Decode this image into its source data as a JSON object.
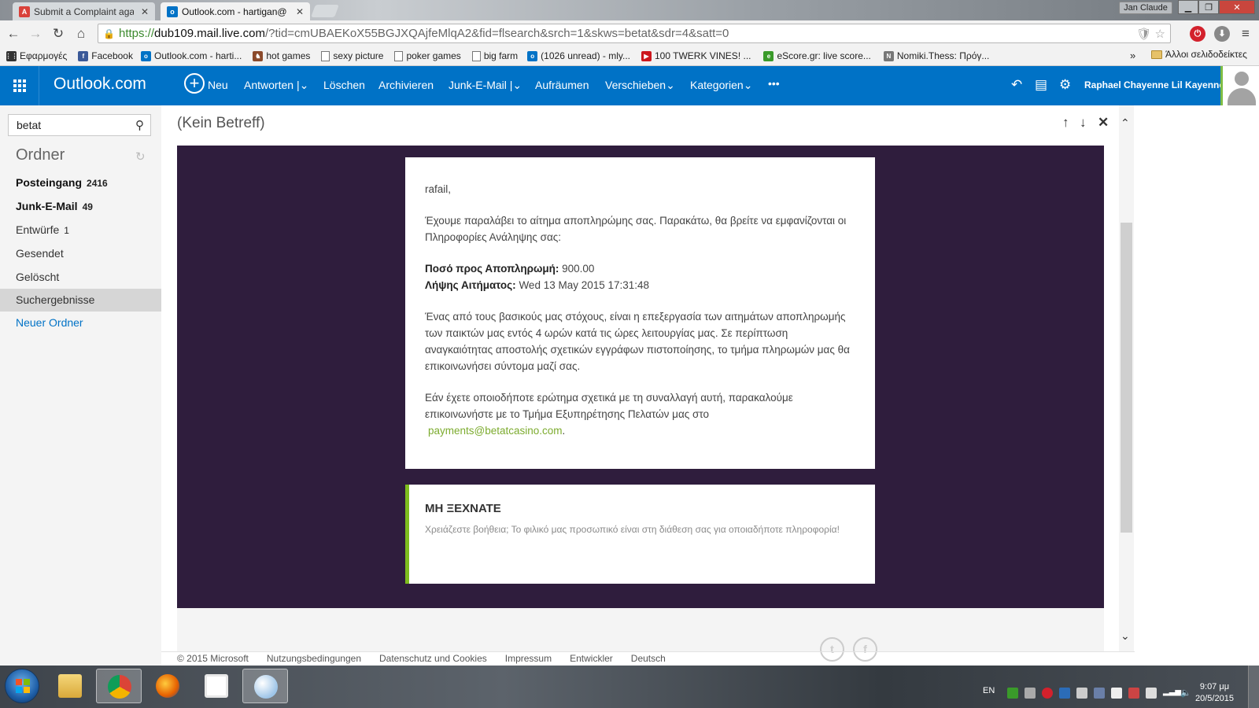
{
  "browser": {
    "tabs": [
      {
        "title": "Submit a Complaint agai",
        "favicon": "A",
        "active": false
      },
      {
        "title": "Outlook.com - hartigan@",
        "favicon": "o",
        "active": true
      }
    ],
    "window_user": "Jan Claude",
    "url": {
      "scheme": "https://",
      "host": "dub109.mail.live.com",
      "rest": "/?tid=cmUBAEKoX55BGJXQAjfeMlqA2&fid=flsearch&srch=1&skws=betat&sdr=4&satt=0"
    },
    "bookmarks": [
      {
        "label": "Εφαρμογές",
        "icon": "apps-grid-icon"
      },
      {
        "label": "Facebook",
        "icon": "facebook-icon"
      },
      {
        "label": "Outlook.com - harti...",
        "icon": "outlook-icon"
      },
      {
        "label": "hot games",
        "icon": "games-icon"
      },
      {
        "label": "sexy picture",
        "icon": "page-icon"
      },
      {
        "label": "poker games",
        "icon": "page-icon"
      },
      {
        "label": "big farm",
        "icon": "page-icon"
      },
      {
        "label": "(1026 unread) - mly...",
        "icon": "outlook-icon"
      },
      {
        "label": "100 TWERK VINES! ...",
        "icon": "youtube-icon"
      },
      {
        "label": "eScore.gr: live score...",
        "icon": "escore-icon"
      },
      {
        "label": "Nomiki.Thess: Πρόγ...",
        "icon": "nomiki-icon"
      }
    ],
    "bookmarks_more": "»",
    "other_bookmarks": "Άλλοι σελιδοδείκτες"
  },
  "outlook": {
    "brand": "Outlook.com",
    "commands": {
      "new": "Neu",
      "reply": "Antworten",
      "delete": "Löschen",
      "archive": "Archivieren",
      "junk": "Junk-E-Mail",
      "sweep": "Aufräumen",
      "move": "Verschieben",
      "categories": "Kategorien",
      "more": "•••"
    },
    "user_name": "Raphael Chayenne Lil Kayenne",
    "search_value": "betat",
    "folders_title": "Ordner",
    "folders": [
      {
        "label": "Posteingang",
        "count": "2416",
        "bold": true
      },
      {
        "label": "Junk-E-Mail",
        "count": "49",
        "bold": true
      },
      {
        "label": "Entwürfe",
        "count": "1",
        "bold": false
      },
      {
        "label": "Gesendet",
        "count": "",
        "bold": false
      },
      {
        "label": "Gelöscht",
        "count": "",
        "bold": false
      },
      {
        "label": "Suchergebnisse",
        "count": "",
        "bold": false,
        "selected": true
      }
    ],
    "new_folder": "Neuer Ordner",
    "footer": [
      "© 2015 Microsoft",
      "Nutzungsbedingungen",
      "Datenschutz und Cookies",
      "Impressum",
      "Entwickler",
      "Deutsch"
    ]
  },
  "message": {
    "subject": "(Kein Betreff)",
    "greeting": "rafail,",
    "intro": "Έχουμε παραλάβει το αίτημα αποπληρώμης σας. Παρακάτω, θα βρείτε να εμφανίζονται οι Πληροφορίες Ανάληψης σας:",
    "amount_label": "Ποσό προς Αποπληρωμή:",
    "amount_value": " 900.00",
    "date_label": "Λήψης Αιτήματος:",
    "date_value": " Wed 13 May 2015 17:31:48",
    "para2": "Ένας από τους βασικούς μας στόχους, είναι η επεξεργασία των αιτημάτων αποπληρωμής των παικτών μας εντός 4 ωρών κατά τις ώρες λειτουργίας μας. Σε περίπτωση αναγκαιότητας αποστολής σχετικών εγγράφων πιστοποίησης, το τμήμα πληρωμών μας θα επικοινωνήσει σύντομα μαζί σας.",
    "para3": "Εάν έχετε οποιοδήποτε ερώτημα σχετικά με τη συναλλαγή αυτή, παρακαλούμε επικοινωνήστε με το Τμήμα Εξυπηρέτησης Πελατών μας στο",
    "email_link": "payments@betatcasino.com",
    "para3_end": ".",
    "reminder_title": "ΜΗ ΞΕΧΝΑΤΕ",
    "reminder_text": "Χρειάζεστε βοήθεια; Το φιλικό μας προσωπικό είναι στη διάθεση σας για οποιαδήποτε πληροφορία!"
  },
  "taskbar": {
    "language": "EN",
    "time": "9:07 μμ",
    "date": "20/5/2015"
  },
  "colors": {
    "outlook_blue": "#0072c6",
    "mail_frame": "#2f1d3d",
    "accent_green": "#7ebd1e",
    "link_green": "#7cab2e"
  }
}
